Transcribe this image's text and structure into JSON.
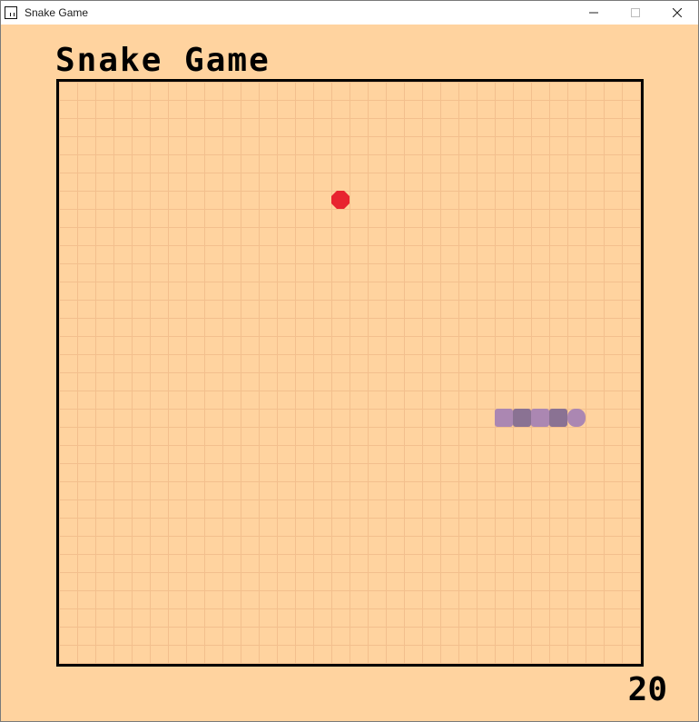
{
  "window": {
    "title": "Snake Game",
    "background": "#ffd39f"
  },
  "game": {
    "title": "Snake Game",
    "score": "20",
    "grid": {
      "columns": 32,
      "rows": 32
    },
    "food": {
      "cell": [
        15,
        6
      ],
      "color": "#e8232f"
    },
    "snake": {
      "direction": "right",
      "colors": [
        "#ab87b2",
        "#8a7293"
      ],
      "cells": [
        [
          24,
          18
        ],
        [
          25,
          18
        ],
        [
          26,
          18
        ],
        [
          27,
          18
        ],
        [
          28,
          18
        ]
      ]
    }
  }
}
